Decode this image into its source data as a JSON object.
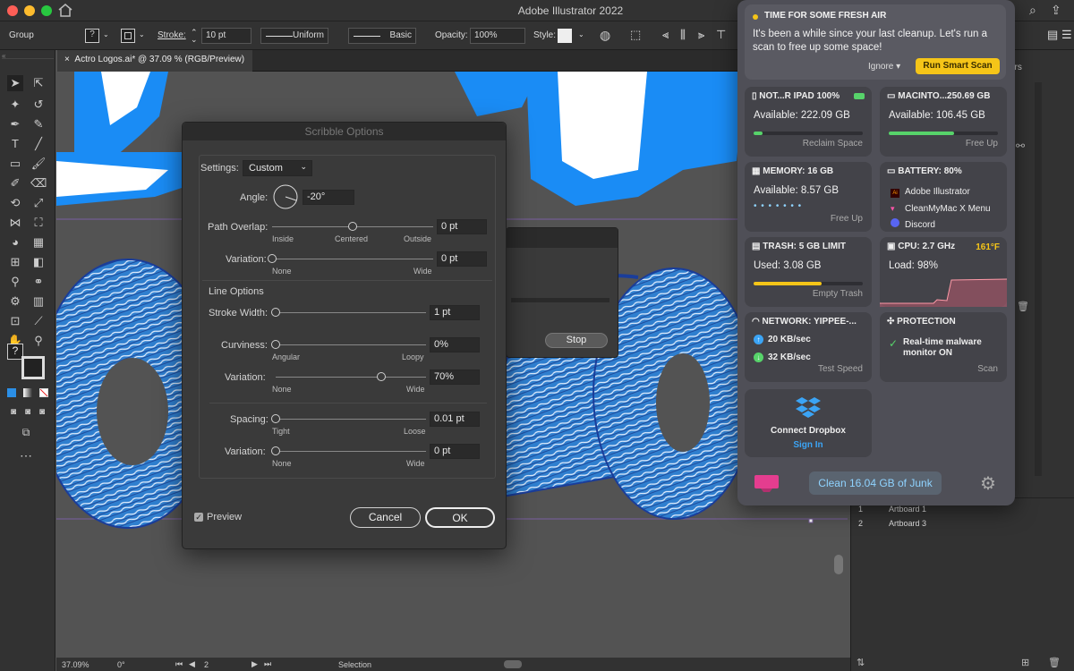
{
  "app": {
    "title": "Adobe Illustrator 2022"
  },
  "control_bar": {
    "selection_type": "Group",
    "stroke_label": "Stroke:",
    "stroke_value": "10 pt",
    "profile": "Uniform",
    "brush": "Basic",
    "opacity_label": "Opacity:",
    "opacity_value": "100%",
    "style_label": "Style:"
  },
  "document_tab": {
    "close": "×",
    "title": "Actro Logos.ai* @ 37.09 % (RGB/Preview)"
  },
  "status_bar": {
    "zoom": "37.09%",
    "rotation": "0°",
    "artboard": "2",
    "tool": "Selection"
  },
  "scribble_dialog": {
    "title": "Scribble Options",
    "settings_label": "Settings:",
    "settings_value": "Custom",
    "angle_label": "Angle:",
    "angle_value": "-20°",
    "path_overlap": {
      "label": "Path Overlap:",
      "value": "0 pt",
      "min": "Inside",
      "mid": "Centered",
      "max": "Outside",
      "position": 0.5
    },
    "variation1": {
      "label": "Variation:",
      "value": "0 pt",
      "min": "None",
      "max": "Wide",
      "position": 0.0
    },
    "line_options_label": "Line Options",
    "stroke_width": {
      "label": "Stroke Width:",
      "value": "1 pt",
      "position": 0.0
    },
    "curviness": {
      "label": "Curviness:",
      "value": "0%",
      "min": "Angular",
      "max": "Loopy",
      "position": 0.0
    },
    "variation2": {
      "label": "Variation:",
      "value": "70%",
      "min": "None",
      "max": "Wide",
      "position": 0.7
    },
    "spacing": {
      "label": "Spacing:",
      "value": "0.01 pt",
      "min": "Tight",
      "max": "Loose",
      "position": 0.0
    },
    "variation3": {
      "label": "Variation:",
      "value": "0 pt",
      "min": "None",
      "max": "Wide",
      "position": 0.0
    },
    "preview_label": "Preview",
    "cancel": "Cancel",
    "ok": "OK"
  },
  "progress_dialog": {
    "stop": "Stop"
  },
  "cleanmymac": {
    "alert_title": "TIME FOR SOME FRESH AIR",
    "alert_text": "It's been a while since your last cleanup. Let's run a scan to free up some space!",
    "ignore": "Ignore",
    "scan_button": "Run Smart Scan",
    "disk1": {
      "title": "NOT...R IPAD 100%",
      "info": "Available: 222.09 GB",
      "action": "Reclaim Space",
      "level": 0.08
    },
    "disk2": {
      "title": "MACINTO...250.69 GB",
      "info": "Available: 106.45 GB",
      "action": "Free Up",
      "level": 0.6
    },
    "memory": {
      "title": "MEMORY: 16 GB",
      "info": "Available: 8.57 GB",
      "action": "Free Up"
    },
    "battery": {
      "title": "BATTERY: 80%",
      "apps": [
        "Adobe Illustrator",
        "CleanMyMac X Menu",
        "Discord"
      ]
    },
    "trash": {
      "title": "TRASH: 5 GB LIMIT",
      "info": "Used: 3.08 GB",
      "action": "Empty Trash",
      "level": 0.62
    },
    "cpu": {
      "title": "CPU: 2.7 GHz",
      "temp": "161°F",
      "info": "Load: 98%"
    },
    "network": {
      "title": "NETWORK: YIPPEE-...",
      "down": "20 KB/sec",
      "up": "32 KB/sec",
      "action": "Test Speed"
    },
    "protection": {
      "title": "PROTECTION",
      "info": "Real-time malware monitor ON",
      "action": "Scan"
    },
    "dropbox": {
      "title": "Connect Dropbox",
      "action": "Sign In"
    },
    "clean_button": "Clean 16.04 GB of Junk",
    "colors": {
      "yellow": "#f5c518",
      "green": "#57d36a",
      "blue": "#3ba4f5",
      "accent": "#8fd3ff"
    }
  },
  "artboards": {
    "rows": [
      {
        "num": "1",
        "name": "Artboard 1"
      },
      {
        "num": "2",
        "name": "Artboard 3"
      }
    ]
  },
  "panel_tab": "ers"
}
